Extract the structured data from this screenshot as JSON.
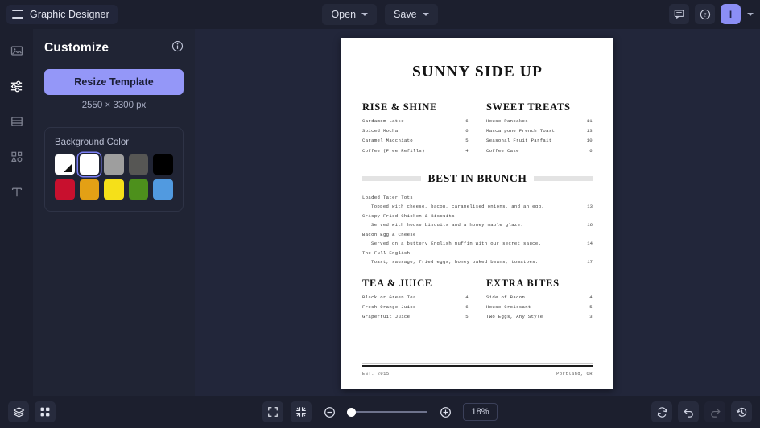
{
  "topbar": {
    "brand": "Graphic Designer",
    "menu_icon": "hamburger-icon",
    "open_label": "Open",
    "save_label": "Save",
    "chat_icon": "chat-icon",
    "help_icon": "help-circle-icon",
    "avatar_initial": "I"
  },
  "rail": {
    "items": [
      {
        "name": "image-icon"
      },
      {
        "name": "adjustments-icon"
      },
      {
        "name": "layout-icon"
      },
      {
        "name": "shapes-icon"
      },
      {
        "name": "text-icon"
      }
    ]
  },
  "panel": {
    "title": "Customize",
    "info_icon": "info-icon",
    "resize_label": "Resize Template",
    "dimensions": "2550 × 3300 px",
    "background": {
      "label": "Background Color",
      "swatches": [
        {
          "name": "transparent",
          "hex": "#ffffff",
          "selected": false
        },
        {
          "name": "white",
          "hex": "#ffffff",
          "selected": true
        },
        {
          "name": "light-gray",
          "hex": "#9e9e9e",
          "selected": false
        },
        {
          "name": "dark-gray",
          "hex": "#565654",
          "selected": false
        },
        {
          "name": "black",
          "hex": "#000000",
          "selected": false
        },
        {
          "name": "crimson",
          "hex": "#c8102e",
          "selected": false
        },
        {
          "name": "amber",
          "hex": "#e3a015",
          "selected": false
        },
        {
          "name": "yellow",
          "hex": "#f5e019",
          "selected": false
        },
        {
          "name": "green",
          "hex": "#4d901c",
          "selected": false
        },
        {
          "name": "blue",
          "hex": "#519ae0",
          "selected": false
        }
      ]
    }
  },
  "document": {
    "title": "SUNNY SIDE UP",
    "sections": [
      {
        "heading": "RISE & SHINE",
        "items": [
          {
            "name": "Cardamom Latte",
            "price": "6"
          },
          {
            "name": "Spiced Mocha",
            "price": "6"
          },
          {
            "name": "Caramel Macchiato",
            "price": "5"
          },
          {
            "name": "Coffee (Free Refills)",
            "price": "4"
          }
        ]
      },
      {
        "heading": "SWEET TREATS",
        "items": [
          {
            "name": "House Pancakes",
            "price": "11"
          },
          {
            "name": "Mascarpone French Toast",
            "price": "13"
          },
          {
            "name": "Seasonal Fruit Parfait",
            "price": "10"
          },
          {
            "name": "Coffee Cake",
            "price": "6"
          }
        ]
      }
    ],
    "feature": {
      "heading": "BEST IN BRUNCH",
      "items": [
        {
          "name": "Loaded Tater Tots",
          "desc": "Topped with cheese, bacon, caramelised onions, and an egg.",
          "price": "13"
        },
        {
          "name": "Crispy Fried Chicken & Biscuits",
          "desc": "Served with house biscuits and a honey maple glaze.",
          "price": "16"
        },
        {
          "name": "Bacon Egg & Cheese",
          "desc": "Served on a buttery English muffin with our secret sauce.",
          "price": "14"
        },
        {
          "name": "The Full English",
          "desc": "Toast, sausage, fried eggs, honey baked beans, tomatoes.",
          "price": "17"
        }
      ]
    },
    "sections2": [
      {
        "heading": "TEA & JUICE",
        "items": [
          {
            "name": "Black or Green Tea",
            "price": "4"
          },
          {
            "name": "Fresh Orange Juice",
            "price": "6"
          },
          {
            "name": "Grapefruit Juice",
            "price": "5"
          }
        ]
      },
      {
        "heading": "EXTRA BITES",
        "items": [
          {
            "name": "Side of Bacon",
            "price": "4"
          },
          {
            "name": "House Croissant",
            "price": "5"
          },
          {
            "name": "Two Eggs, Any Style",
            "price": "3"
          }
        ]
      }
    ],
    "footer_left": "EST. 2015",
    "footer_right": "Portland, OR"
  },
  "bottombar": {
    "layers_icon": "layers-icon",
    "grid_icon": "grid-icon",
    "fullscreen_icon": "expand-icon",
    "fit_icon": "collapse-icon",
    "zoom_out_icon": "zoom-out-icon",
    "zoom_in_icon": "zoom-in-icon",
    "zoom_level": "18%",
    "sync_icon": "sync-icon",
    "undo_icon": "undo-icon",
    "redo_icon": "redo-icon",
    "history_icon": "history-icon"
  },
  "colors": {
    "accent": "#9497f8",
    "topbar_bg": "#1c1f2e",
    "panel_bg": "#202434",
    "canvas_bg": "#22263a"
  }
}
